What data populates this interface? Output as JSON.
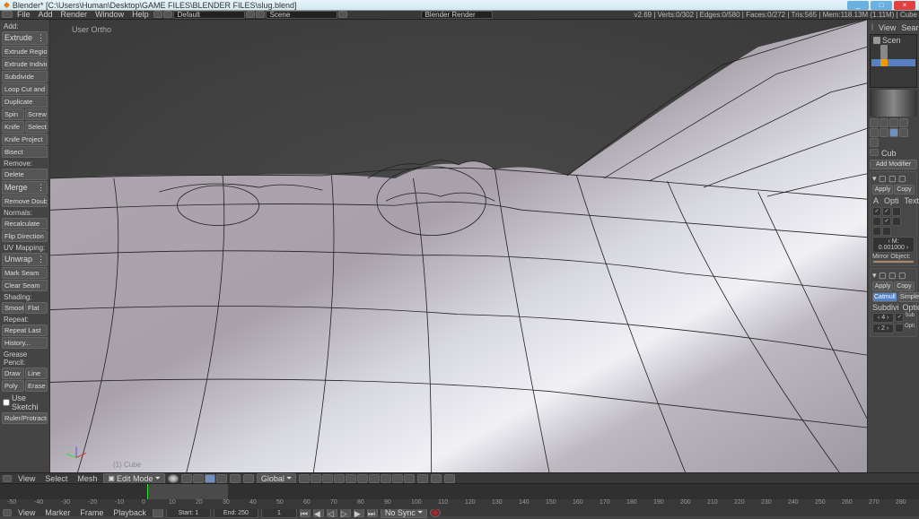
{
  "window": {
    "title": "Blender* [C:\\Users\\Human\\Desktop\\GAME FILES\\BLENDER FILES\\slug.blend]",
    "min": "_",
    "max": "□",
    "close": "×"
  },
  "info": {
    "menus": [
      "File",
      "Add",
      "Render",
      "Window",
      "Help"
    ],
    "scene_label": "Scene",
    "layout_label": "Default",
    "engine": "Blender Render",
    "stats": "v2.69 | Verts:0/302 | Edges:0/580 | Faces:0/272 | Tris:565 | Mem:118.13M (1.11M) | Cube"
  },
  "tools": {
    "add": "Add:",
    "extrude": "Extrude",
    "extrude_region": "Extrude Region",
    "extrude_individ": "Extrude Individu",
    "subdivide": "Subdivide",
    "loopcut": "Loop Cut and Sli",
    "duplicate": "Duplicate",
    "spin": "Spin",
    "screw": "Screw",
    "knife": "Knife",
    "select": "Select",
    "knife_project": "Knife Project",
    "bisect": "Bisect",
    "remove": "Remove:",
    "delete": "Delete",
    "merge": "Merge",
    "remove_doubles": "Remove Double",
    "normals": "Normals:",
    "recalculate": "Recalculate",
    "flip": "Flip Direction",
    "uv": "UV Mapping:",
    "unwrap": "Unwrap",
    "mark_seam": "Mark Seam",
    "clear_seam": "Clear Seam",
    "shading": "Shading:",
    "smooth": "Smoot",
    "flat": "Flat",
    "repeat": "Repeat:",
    "repeat_last": "Repeat Last",
    "history": "History...",
    "grease": "Grease Pencil:",
    "draw": "Draw",
    "line": "Line",
    "poly": "Poly",
    "erase": "Erase",
    "sketch": "Use Sketchi",
    "ruler": "Ruler/Protractor"
  },
  "viewport": {
    "label": "User Ortho",
    "object": "(1) Cube"
  },
  "v3d": {
    "view": "View",
    "select": "Select",
    "mesh": "Mesh",
    "mode": "Edit Mode",
    "orient": "Global"
  },
  "right": {
    "view": "View",
    "search": "Sear",
    "outliner_scene": "Scen",
    "cube": "Cub",
    "add_modifier": "Add Modifier",
    "apply": "Apply",
    "copy": "Copy",
    "a": "A",
    "opti": "Opti",
    "text": "Text",
    "merge_val": "‹ M: 0.001000 ›",
    "mirror_obj": "Mirror Object:",
    "catmull": "Catmull",
    "simple": "Simple",
    "subdivi": "Subdivi",
    "options": "Option",
    "view_num": "‹ 4 ›",
    "sub": "Sub",
    "rend_num": "‹ 2 ›",
    "opt": "Opti"
  },
  "timeline": {
    "view": "View",
    "marker": "Marker",
    "frame": "Frame",
    "playback": "Playback",
    "start": "Start: 1",
    "end": "End: 250",
    "current": "1",
    "sync": "No Sync",
    "ticks": [
      "-50",
      "-40",
      "-30",
      "-20",
      "-10",
      "0",
      "10",
      "20",
      "30",
      "40",
      "50",
      "60",
      "70",
      "80",
      "90",
      "100",
      "110",
      "120",
      "130",
      "140",
      "150",
      "160",
      "170",
      "180",
      "190",
      "200",
      "210",
      "220",
      "230",
      "240",
      "250",
      "260",
      "270",
      "280"
    ]
  }
}
